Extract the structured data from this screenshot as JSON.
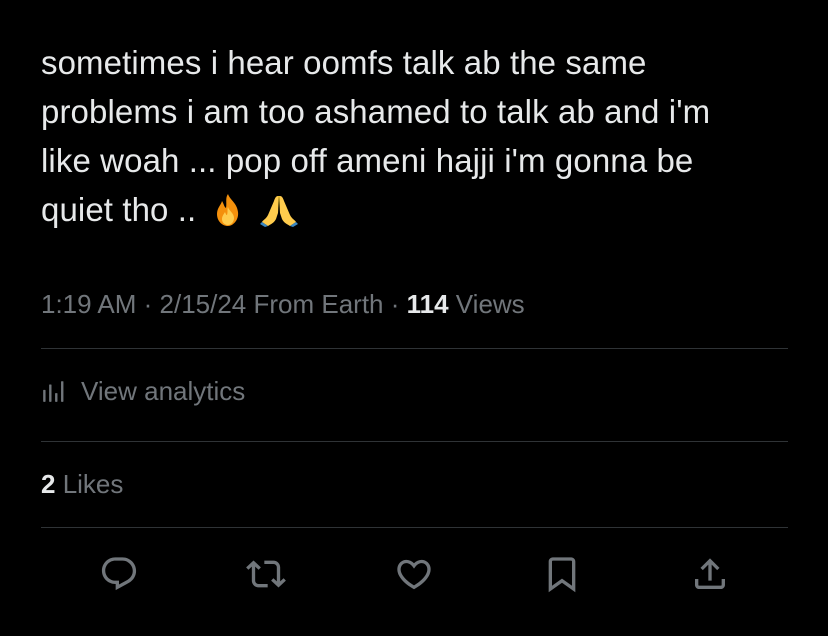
{
  "tweet": {
    "lines": [
      "sometimes i hear oomfs talk ab the same",
      "problems i am too ashamed to talk ab and i'm",
      "like woah ... pop off ameni hajji i'm gonna be",
      "quiet tho .."
    ],
    "emojis": [
      "🔥",
      "🙏"
    ]
  },
  "meta": {
    "time": "1:19 AM",
    "separator": " · ",
    "date": "2/15/24",
    "source": " From Earth",
    "views_count": "114",
    "views_label": " Views"
  },
  "analytics": {
    "label": "View analytics",
    "icon": "bar-chart-icon"
  },
  "likes": {
    "count": "2",
    "label": " Likes"
  },
  "actions": [
    {
      "name": "reply",
      "icon": "reply-icon"
    },
    {
      "name": "retweet",
      "icon": "retweet-icon"
    },
    {
      "name": "like",
      "icon": "heart-icon"
    },
    {
      "name": "bookmark",
      "icon": "bookmark-icon"
    },
    {
      "name": "share",
      "icon": "share-icon"
    }
  ],
  "colors": {
    "background": "#000000",
    "text": "#e7e9ea",
    "secondary": "#71767b",
    "divider": "#2f3336"
  }
}
